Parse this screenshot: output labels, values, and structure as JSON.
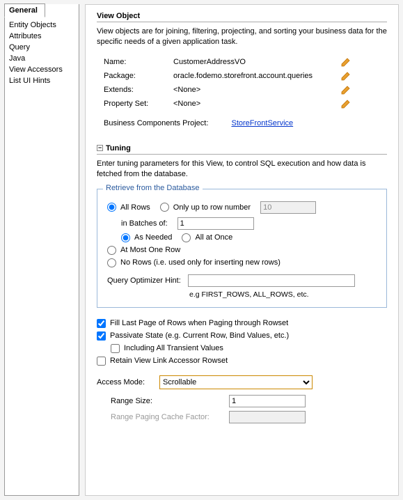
{
  "sidebar": {
    "active_tab": "General",
    "items": [
      "Entity Objects",
      "Attributes",
      "Query",
      "Java",
      "View Accessors",
      "List UI Hints"
    ]
  },
  "view_object": {
    "title": "View Object",
    "description": "View objects are for joining, filtering, projecting, and sorting your business data for the specific needs of a given application task.",
    "props": {
      "name_label": "Name:",
      "name_value": "CustomerAddressVO",
      "package_label": "Package:",
      "package_value": "oracle.fodemo.storefront.account.queries",
      "extends_label": "Extends:",
      "extends_value": "<None>",
      "propset_label": "Property Set:",
      "propset_value": "<None>"
    },
    "biz_label": "Business Components Project:",
    "biz_value": "StoreFrontService"
  },
  "tuning": {
    "title": "Tuning",
    "description": "Enter tuning parameters for this View, to control SQL execution and how data is fetched from the database.",
    "fieldset_legend": "Retrieve from the Database",
    "all_rows_label": "All Rows",
    "only_up_to_label": "Only up to row number",
    "only_up_to_value": "10",
    "in_batches_label": "in Batches of:",
    "in_batches_value": "1",
    "as_needed_label": "As Needed",
    "all_at_once_label": "All at Once",
    "at_most_one_label": "At Most One Row",
    "no_rows_label": "No Rows (i.e. used only for inserting new rows)",
    "qoh_label": "Query Optimizer Hint:",
    "qoh_value": "",
    "qoh_hint": "e.g FIRST_ROWS, ALL_ROWS, etc.",
    "fill_last_label": "Fill Last Page of Rows when Paging through Rowset",
    "passivate_label": "Passivate State (e.g. Current Row, Bind Values, etc.)",
    "include_transient_label": "Including All Transient Values",
    "retain_vla_label": "Retain View Link Accessor Rowset",
    "access_mode_label": "Access Mode:",
    "access_mode_value": "Scrollable",
    "range_size_label": "Range Size:",
    "range_size_value": "1",
    "range_cache_label": "Range Paging Cache Factor:",
    "range_cache_value": ""
  }
}
